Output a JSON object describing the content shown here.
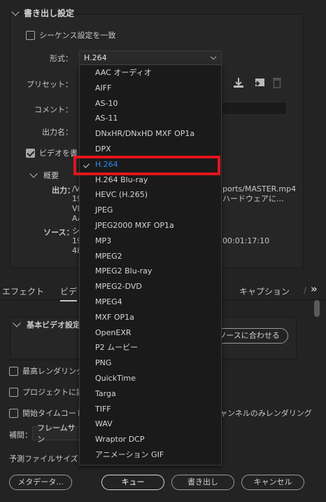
{
  "export_settings": {
    "section_title": "書き出し設定",
    "match_sequence_label": "シーケンス設定を一致",
    "format_label": "形式：",
    "format_value": "H.264",
    "preset_label": "プリセット：",
    "comment_label": "コメント：",
    "output_name_label": "出力名：",
    "export_video_label": "ビデオを書",
    "summary_title": "概要",
    "output_label": "出力：",
    "output_lines": [
      "/V",
      "19",
      "VE",
      "AA"
    ],
    "output_right": [
      "ports/MASTER.mp4",
      "ハードウェアに..."
    ],
    "source_label": "ソース：",
    "source_lines": [
      "シ",
      "19",
      "48"
    ],
    "source_right": "00:01:17:10"
  },
  "tabs": {
    "effects": "エフェクト",
    "video": "ビデ",
    "captions": "キャプション",
    "more": "»"
  },
  "video_section": {
    "basic_video_settings": "基本ビデオ設定",
    "match_source_button": "ソースに合わせる"
  },
  "bottom": {
    "max_render_label": "最高レンダリング",
    "project_label": "プロジェクトに読",
    "start_timecode_label": "開始タイムコード",
    "alpha_label": "ャンネルのみレンダリング",
    "interp_label": "補間：",
    "interp_value": "フレームサン",
    "file_size_label": "予測ファイルサイズ"
  },
  "buttons": {
    "metadata": "メタデータ...",
    "queue": "キュー",
    "export": "書き出し",
    "cancel": "キャンセル"
  },
  "format_dropdown": {
    "options": [
      "AAC オーディオ",
      "AIFF",
      "AS-10",
      "AS-11",
      "DNxHR/DNxHD MXF OP1a",
      "DPX",
      "H.264",
      "H.264 Blu-ray",
      "HEVC (H.265)",
      "JPEG",
      "JPEG2000 MXF OP1a",
      "MP3",
      "MPEG2",
      "MPEG2 Blu-ray",
      "MPEG2-DVD",
      "MPEG4",
      "MXF OP1a",
      "OpenEXR",
      "P2 ムービー",
      "PNG",
      "QuickTime",
      "Targa",
      "TIFF",
      "WAV",
      "Wraptor DCP",
      "アニメーション GIF"
    ],
    "selected_index": 6
  },
  "colors": {
    "background": "#232323",
    "selected_text": "#2d8ceb",
    "highlight_box": "#e0151b"
  },
  "icons": [
    "chevron-down-icon",
    "download-icon",
    "import-icon",
    "trash-icon",
    "checkmark-icon"
  ]
}
